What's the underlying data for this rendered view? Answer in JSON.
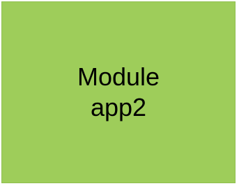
{
  "module": {
    "line1": "Module",
    "line2": "app2",
    "fill_color": "#9ecd5a"
  }
}
